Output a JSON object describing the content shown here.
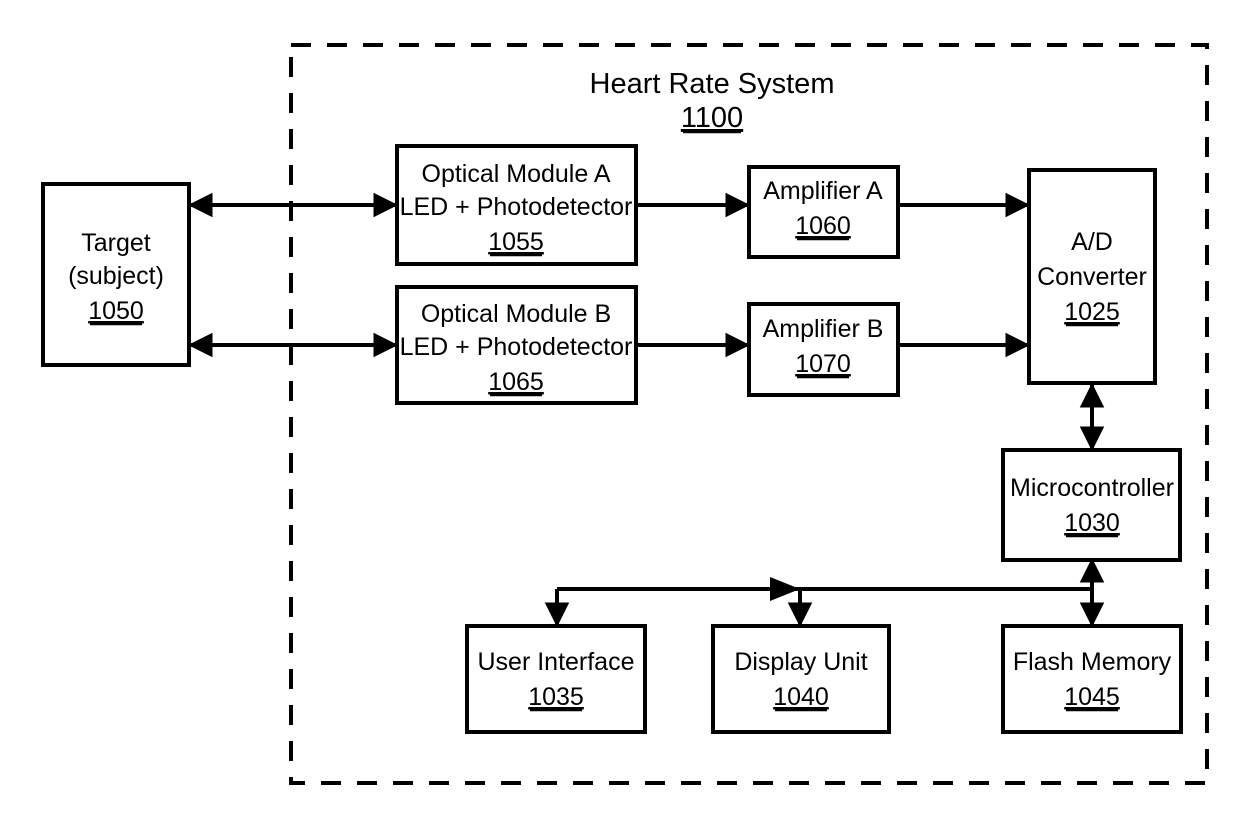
{
  "figure": {
    "type": "block-diagram",
    "boundary": {
      "label": "Heart Rate System",
      "reference_numeral": "1100",
      "style": "dashed"
    },
    "blocks": [
      {
        "id": "target",
        "lines": [
          "Target",
          "(subject)"
        ],
        "line1": "Target",
        "line2": "(subject)",
        "reference_numeral": "1050"
      },
      {
        "id": "optical-module-a",
        "line1": "Optical Module A",
        "line2": "LED + Photodetector",
        "reference_numeral": "1055"
      },
      {
        "id": "optical-module-b",
        "line1": "Optical Module B",
        "line2": "LED + Photodetector",
        "reference_numeral": "1065"
      },
      {
        "id": "amplifier-a",
        "line1": "Amplifier A",
        "reference_numeral": "1060"
      },
      {
        "id": "amplifier-b",
        "line1": "Amplifier B",
        "reference_numeral": "1070"
      },
      {
        "id": "ad-converter",
        "line1": "A/D",
        "line2": "Converter",
        "reference_numeral": "1025"
      },
      {
        "id": "microcontroller",
        "line1": "Microcontroller",
        "reference_numeral": "1030"
      },
      {
        "id": "user-interface",
        "line1": "User Interface",
        "reference_numeral": "1035"
      },
      {
        "id": "display-unit",
        "line1": "Display Unit",
        "reference_numeral": "1040"
      },
      {
        "id": "flash-memory",
        "line1": "Flash Memory",
        "reference_numeral": "1045"
      }
    ],
    "connections": [
      {
        "from": "target",
        "to": "optical-module-a",
        "direction": "bidirectional"
      },
      {
        "from": "target",
        "to": "optical-module-b",
        "direction": "bidirectional"
      },
      {
        "from": "optical-module-a",
        "to": "amplifier-a",
        "direction": "unidirectional"
      },
      {
        "from": "optical-module-b",
        "to": "amplifier-b",
        "direction": "unidirectional"
      },
      {
        "from": "amplifier-a",
        "to": "ad-converter",
        "direction": "unidirectional"
      },
      {
        "from": "amplifier-b",
        "to": "ad-converter",
        "direction": "unidirectional"
      },
      {
        "from": "ad-converter",
        "to": "microcontroller",
        "direction": "bidirectional"
      },
      {
        "from": "microcontroller",
        "to": "flash-memory",
        "direction": "bidirectional"
      },
      {
        "from": "microcontroller",
        "to": "user-interface",
        "direction": "unidirectional"
      },
      {
        "from": "microcontroller",
        "to": "display-unit",
        "direction": "unidirectional"
      }
    ],
    "colors": {
      "stroke": "#000000",
      "fill": "#ffffff",
      "background": "#ffffff"
    }
  }
}
